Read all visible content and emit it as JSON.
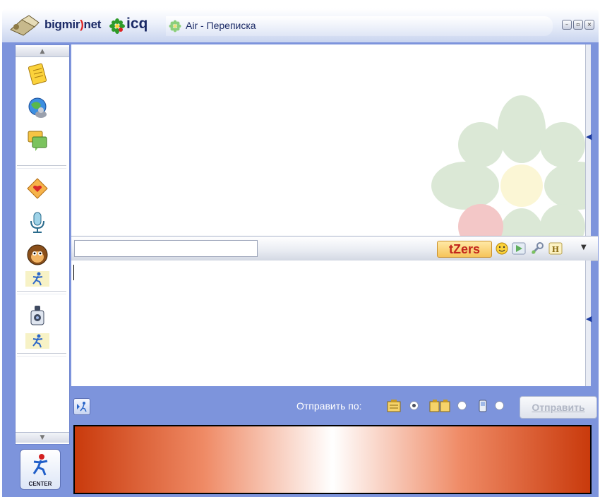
{
  "title_bar": {
    "brand_part1": "bigmir",
    "brand_paren": ")",
    "brand_part2": "net",
    "icq_label": "icq",
    "window_title": "Air - Переписка",
    "buttons": [
      "minimize",
      "restore",
      "close"
    ]
  },
  "sidebar": {
    "icons": [
      "notes-icon",
      "globe-people-icon",
      "chat-messages-icon",
      "greeting-card-icon",
      "microphone-icon",
      "monkey-face-icon",
      "running-man-icon",
      "robot-icon",
      "running-man-icon"
    ],
    "center_label": "CENTER"
  },
  "toolbar": {
    "tzers_label": "tZers",
    "icons": [
      "smiley-icon",
      "send-file-icon",
      "tools-icon",
      "history-icon"
    ]
  },
  "bottom": {
    "send_via_label": "Отправить по:",
    "send_button_label": "Отправить",
    "via_options": [
      {
        "icon": "icq-message-icon",
        "selected": true
      },
      {
        "icon": "sms-icon",
        "selected": false
      },
      {
        "icon": "mobile-icon",
        "selected": false
      }
    ]
  },
  "colors": {
    "panel": "#7d94dc",
    "brand_text": "#1b2a66",
    "tzers_red": "#c2261c",
    "banner_edge": "#c93a0c"
  }
}
